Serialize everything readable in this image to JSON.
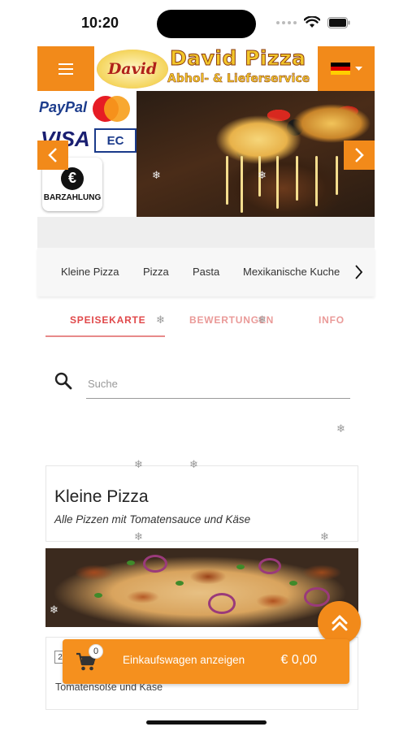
{
  "status_bar": {
    "time": "10:20"
  },
  "header": {
    "logo_text": "David",
    "brand_name": "David Pizza",
    "brand_subtitle": "Abhol- & Lieferservice",
    "flag_colors": [
      "#000000",
      "#dd0000",
      "#ffce00"
    ]
  },
  "payments": {
    "paypal_label": "PayPal",
    "visa_label": "VISA",
    "ec_label": "EC",
    "cash_symbol": "€",
    "cash_label": "BARZAHLUNG"
  },
  "categories": [
    "Kleine Pizza",
    "Pizza",
    "Pasta",
    "Mexikanische Kuche"
  ],
  "tabs": {
    "menu": "SPEISEKARTE",
    "reviews": "BEWERTUNGEN",
    "info": "INFO"
  },
  "search": {
    "placeholder": "Suche",
    "value": ""
  },
  "section": {
    "title": "Kleine Pizza",
    "subtitle": "Alle Pizzen mit Tomatensauce und Käse"
  },
  "product": {
    "number": "2",
    "description": "Tomatensoße und Käse"
  },
  "cart": {
    "count": "0",
    "label": "Einkaufswagen anzeigen",
    "total": "€ 0,00"
  },
  "colors": {
    "accent": "#f28a1a",
    "tab_active": "#e0484a",
    "tab_inactive": "#ea9a98"
  }
}
